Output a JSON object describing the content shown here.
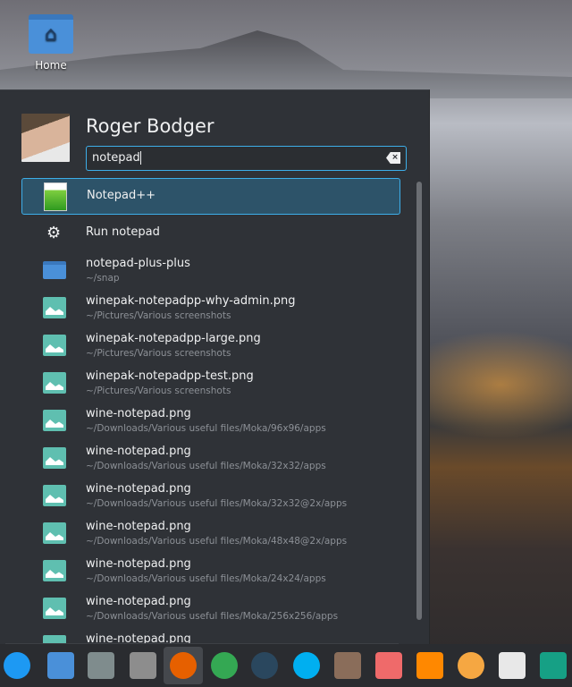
{
  "desktop": {
    "home_label": "Home"
  },
  "user": {
    "name": "Roger Bodger"
  },
  "search": {
    "value": "notepad"
  },
  "results": [
    {
      "title": "Notepad++",
      "subtitle": "",
      "icon": "notepadpp-icon",
      "selected": true
    },
    {
      "title": "Run notepad",
      "subtitle": "",
      "icon": "gears-icon"
    },
    {
      "title": "notepad-plus-plus",
      "subtitle": "~/snap",
      "icon": "folder-icon"
    },
    {
      "title": "winepak-notepadpp-why-admin.png",
      "subtitle": "~/Pictures/Various screenshots",
      "icon": "image-icon"
    },
    {
      "title": "winepak-notepadpp-large.png",
      "subtitle": "~/Pictures/Various screenshots",
      "icon": "image-icon"
    },
    {
      "title": "winepak-notepadpp-test.png",
      "subtitle": "~/Pictures/Various screenshots",
      "icon": "image-icon"
    },
    {
      "title": "wine-notepad.png",
      "subtitle": "~/Downloads/Various useful files/Moka/96x96/apps",
      "icon": "image-icon"
    },
    {
      "title": "wine-notepad.png",
      "subtitle": "~/Downloads/Various useful files/Moka/32x32/apps",
      "icon": "image-icon"
    },
    {
      "title": "wine-notepad.png",
      "subtitle": "~/Downloads/Various useful files/Moka/32x32@2x/apps",
      "icon": "image-icon"
    },
    {
      "title": "wine-notepad.png",
      "subtitle": "~/Downloads/Various useful files/Moka/48x48@2x/apps",
      "icon": "image-icon"
    },
    {
      "title": "wine-notepad.png",
      "subtitle": "~/Downloads/Various useful files/Moka/24x24/apps",
      "icon": "image-icon"
    },
    {
      "title": "wine-notepad.png",
      "subtitle": "~/Downloads/Various useful files/Moka/256x256/apps",
      "icon": "image-icon"
    },
    {
      "title": "wine-notepad.png",
      "subtitle": "",
      "icon": "image-icon"
    }
  ],
  "taskbar": [
    {
      "name": "kde-launcher-icon",
      "color": "#1d99f3"
    },
    {
      "name": "show-desktop-icon",
      "color": "#4a90d9"
    },
    {
      "name": "screenshot-icon",
      "color": "#7f8c8d"
    },
    {
      "name": "file-manager-icon",
      "color": "#8d8d8d"
    },
    {
      "name": "firefox-icon",
      "color": "#e66000",
      "active": true
    },
    {
      "name": "chrome-icon",
      "color": "#34a853"
    },
    {
      "name": "steam-icon",
      "color": "#2a475e"
    },
    {
      "name": "skype-icon",
      "color": "#00aff0"
    },
    {
      "name": "krita-icon",
      "color": "#8a6d5a"
    },
    {
      "name": "photo-viewer-icon",
      "color": "#ef6a6a"
    },
    {
      "name": "vlc-icon",
      "color": "#ff8800"
    },
    {
      "name": "orange-app-icon",
      "color": "#f5a742"
    },
    {
      "name": "document-icon",
      "color": "#e8e8e8"
    },
    {
      "name": "ebook-icon",
      "color": "#16a085"
    }
  ],
  "colors": {
    "accent": "#3daee9",
    "panel": "#2f3237",
    "selection": "#2d5369"
  }
}
